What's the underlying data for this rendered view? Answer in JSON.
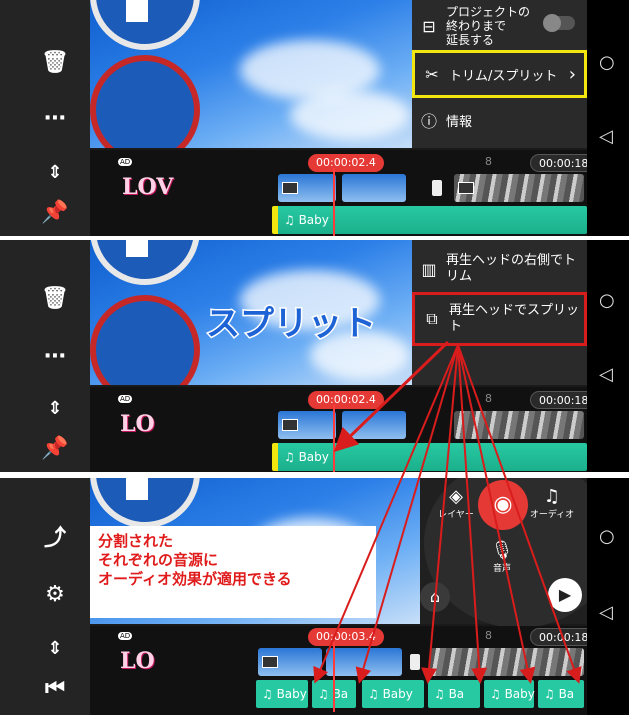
{
  "panel1": {
    "menu": {
      "extend_label": "プロジェクトの\n終わりまで\n延長する",
      "trim_split_label": "トリム/スプリット",
      "trim_split_chevron": "›",
      "info_label": "情報"
    },
    "timecode_current": "00:00:02.4",
    "timecode_end": "00:00:18.00",
    "ruler_mark": "8",
    "audio_label": "Baby",
    "logo_text": "LOV",
    "ad_label": "AD"
  },
  "panel2": {
    "menu": {
      "trim_right_label": "再生ヘッドの右側でトリム",
      "split_label": "再生ヘッドでスプリット"
    },
    "overlay_title": "スプリット",
    "timecode_current": "00:00:02.4",
    "timecode_end": "00:00:18.00",
    "ruler_mark": "8",
    "audio_label": "Baby",
    "logo_text": "LO",
    "ad_label": "AD"
  },
  "panel3": {
    "radial": {
      "layer_label": "レイヤー",
      "audio_label": "オーディオ",
      "voice_label": "音声"
    },
    "annotation_lines": [
      "分割された",
      "それぞれの音源に",
      "オーディオ効果が適用できる"
    ],
    "timecode_current": "00:00:03.4",
    "timecode_end": "00:00:18.00",
    "ruler_mark": "8",
    "audio_segments": [
      "Baby",
      "Ba",
      "Baby",
      "Ba",
      "Baby",
      "Ba"
    ],
    "logo_text": "LO",
    "ad_label": "AD"
  },
  "colors": {
    "highlight_yellow": "#f1e60e",
    "highlight_red": "#d91c1c",
    "audio_teal": "#27c9a2",
    "record_red": "#e53935",
    "overlay_title_blue": "#1e63d6"
  },
  "icons": [
    "circle-home-icon",
    "triangle-back-icon",
    "trash-icon",
    "more-icon",
    "split-vertical-icon",
    "pin-icon",
    "share-icon",
    "settings-icon",
    "skip-start-icon",
    "scissors-icon",
    "info-icon",
    "layers-icon",
    "music-icon",
    "mic-icon",
    "record-icon",
    "play-icon",
    "store-icon"
  ]
}
